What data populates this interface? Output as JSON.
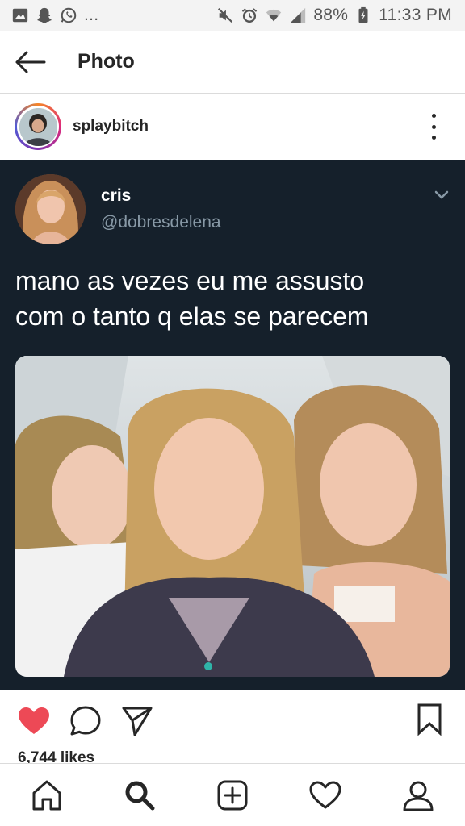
{
  "status_bar": {
    "left_icons": [
      "image-icon",
      "snapchat-icon",
      "whatsapp-icon"
    ],
    "overflow": "...",
    "right_icons": [
      "mute-icon",
      "alarm-icon",
      "wifi-icon",
      "signal-icon",
      "battery-icon"
    ],
    "battery": "88%",
    "time": "11:33 PM"
  },
  "app_bar": {
    "back_icon": "arrow-left-icon",
    "title": "Photo"
  },
  "post": {
    "username": "splaybitch",
    "more_icon": "more-vertical-icon"
  },
  "tweet": {
    "name": "cris",
    "handle": "@dobresdelena",
    "text_lines": [
      "mano as vezes eu me assusto",
      "com o tanto q elas se parecem"
    ]
  },
  "actions": {
    "liked": true,
    "like_color": "#ed4956",
    "likes_text": "6,744 likes"
  },
  "bottom_nav": {
    "items": [
      "home-icon",
      "search-icon",
      "add-post-icon",
      "activity-heart-icon",
      "profile-icon"
    ]
  },
  "colors": {
    "tweet_background": "#15202b",
    "tweet_handle": "#8899a6",
    "text": "#262626"
  }
}
